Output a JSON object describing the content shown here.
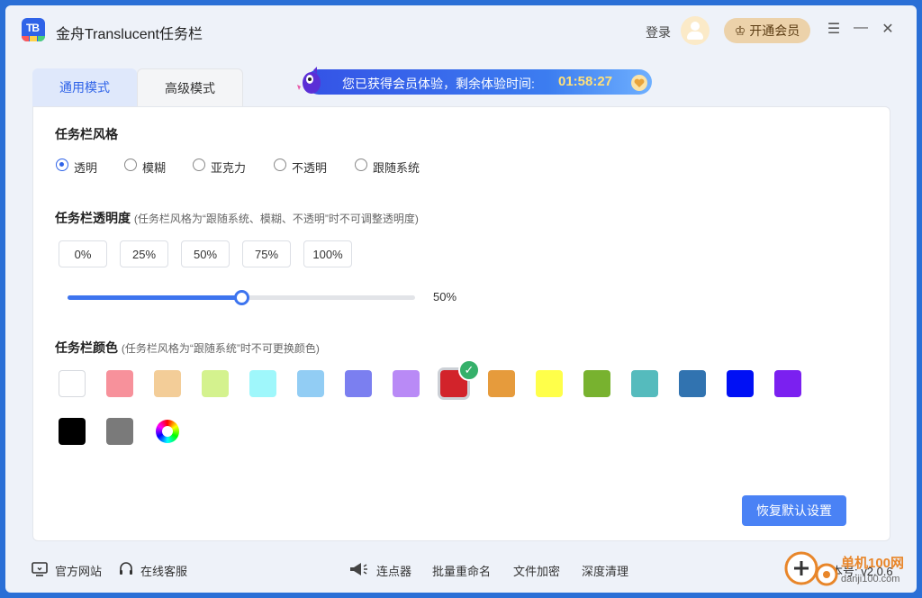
{
  "app": {
    "title": "金舟Translucent任务栏",
    "logo_text": "TB"
  },
  "header": {
    "login": "登录",
    "vip_button": "开通会员"
  },
  "window_controls": {
    "menu": "☰",
    "minimize": "—",
    "close": "✕"
  },
  "tabs": [
    {
      "label": "通用模式",
      "active": true
    },
    {
      "label": "高级模式",
      "active": false
    }
  ],
  "banner": {
    "text": "您已获得会员体验，剩余体验时间:",
    "time": "01:58:27"
  },
  "style_section": {
    "title": "任务栏风格",
    "options": [
      {
        "label": "透明",
        "selected": true
      },
      {
        "label": "模糊",
        "selected": false
      },
      {
        "label": "亚克力",
        "selected": false
      },
      {
        "label": "不透明",
        "selected": false
      },
      {
        "label": "跟随系统",
        "selected": false
      }
    ]
  },
  "opacity_section": {
    "title": "任务栏透明度",
    "note": "(任务栏风格为“跟随系统、模糊、不透明”时不可调整透明度)",
    "presets": [
      "0%",
      "25%",
      "50%",
      "75%",
      "100%"
    ],
    "value_label": "50%",
    "value": 0.5
  },
  "color_section": {
    "title": "任务栏颜色",
    "note": "(任务栏风格为“跟随系统”时不可更换颜色)",
    "colors": [
      "#ffffff",
      "#f7919b",
      "#f3cd98",
      "#d4f28e",
      "#9ff7fb",
      "#92cdf4",
      "#7b7ff0",
      "#b98af6",
      "#d2232b",
      "#e69b3c",
      "#ffff4a",
      "#78b22f",
      "#55bbbd",
      "#3173b0",
      "#0010f5",
      "#7b20f0",
      "#000000",
      "#7a7a7a"
    ],
    "selected_index": 8
  },
  "reset_button": "恢复默认设置",
  "footer": {
    "left": [
      {
        "label": "官方网站",
        "icon": "monitor-icon"
      },
      {
        "label": "在线客服",
        "icon": "headset-icon"
      }
    ],
    "center": [
      {
        "label": "连点器",
        "icon": "megaphone-icon"
      },
      {
        "label": "批量重命名"
      },
      {
        "label": "文件加密"
      },
      {
        "label": "深度清理"
      }
    ],
    "version": "版本号: v2.0.6"
  },
  "watermark": {
    "text": "单机100网",
    "url": "danji100.com"
  },
  "accent": "#2f63e8"
}
